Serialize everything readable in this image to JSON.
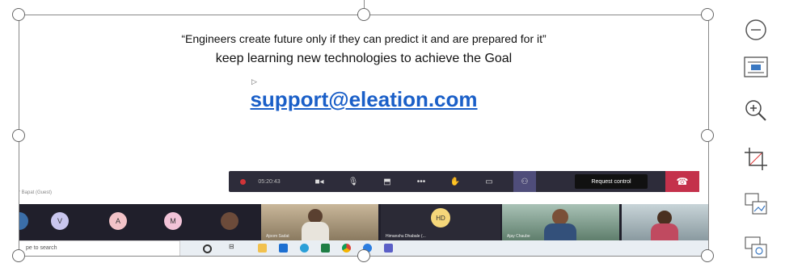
{
  "slide": {
    "quote": "“Engineers create future only if they can predict it and are prepared for it”",
    "subline": "keep learning new technologies to achieve the Goal",
    "email": "support@eleation.com"
  },
  "meeting": {
    "guest_label": "r Bapat (Guest)",
    "timer": "05:20:43",
    "request_control": "Request control",
    "participants": [
      {
        "initial": "V",
        "color": "#c9c6ee"
      },
      {
        "initial": "A",
        "color": "#f3c3c8"
      },
      {
        "initial": "M",
        "color": "#f2c3d8"
      }
    ],
    "video_tiles": [
      {
        "name": "Ajoom Sadat",
        "initials": ""
      },
      {
        "name": "Himanshu Dhabale (...",
        "initials": "HD"
      },
      {
        "name": "Ajay Chaube",
        "initials": ""
      },
      {
        "name": "",
        "initials": ""
      }
    ]
  },
  "taskbar": {
    "search_placeholder": "pe to search"
  },
  "side_tools": [
    "minus-circle-icon",
    "layout-options-icon",
    "zoom-in-icon",
    "crop-icon",
    "replace-image-icon",
    "alt-text-icon"
  ]
}
